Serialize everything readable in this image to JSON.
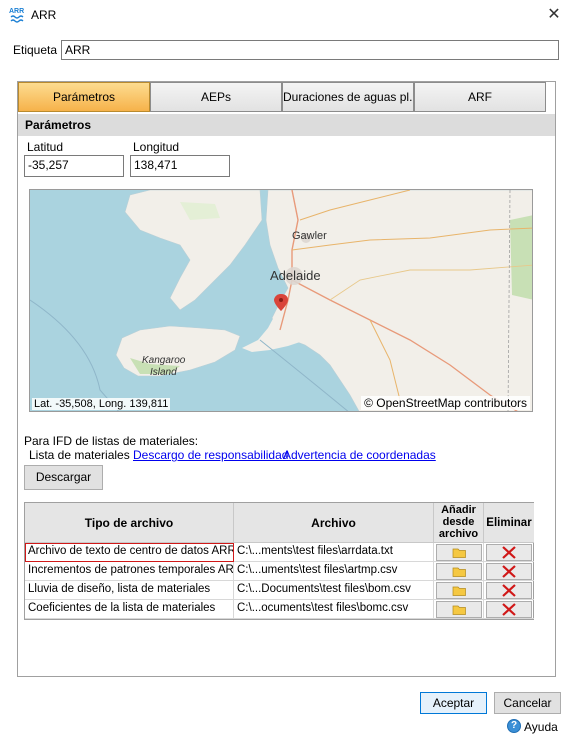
{
  "window": {
    "title": "ARR",
    "icon_text": "ARR"
  },
  "etiqueta": {
    "label": "Etiqueta",
    "value": "ARR"
  },
  "tabs": [
    {
      "label": "Parámetros",
      "active": true
    },
    {
      "label": "AEPs",
      "active": false
    },
    {
      "label": "Duraciones de aguas pl...",
      "active": false
    },
    {
      "label": "ARF",
      "active": false
    }
  ],
  "section": {
    "title": "Parámetros"
  },
  "latitud": {
    "label": "Latitud",
    "value": "-35,257"
  },
  "longitud": {
    "label": "Longitud",
    "value": "138,471"
  },
  "map": {
    "coords": "Lat. -35,508, Long. 139,811",
    "attribution": "© OpenStreetMap contributors",
    "places": {
      "gawler": "Gawler",
      "adelaide": "Adelaide",
      "kangaroo1": "Kangaroo",
      "kangaroo2": "Island"
    },
    "colors": {
      "sea": "#aad3df",
      "land": "#f2efe9",
      "park": "#c8e0b5",
      "marker": "#d9443a"
    }
  },
  "ifd": {
    "caption": "Para IFD de listas de materiales:",
    "lista_label": "Lista de materiales",
    "link_descargo": "Descargo de responsabilidad",
    "link_advertencia": "Advertencia de coordenadas",
    "download_button": "Descargar"
  },
  "table": {
    "headers": {
      "tipo": "Tipo de archivo",
      "archivo": "Archivo",
      "anadir1": "Añadir",
      "anadir2": "desde",
      "anadir3": "archivo",
      "eliminar": "Eliminar"
    },
    "rows": [
      {
        "tipo": "Archivo de texto de centro de datos ARR",
        "archivo": "C:\\...ments\\test files\\arrdata.txt"
      },
      {
        "tipo": "Incrementos de patrones temporales ARR",
        "archivo": "C:\\...uments\\test files\\artmp.csv"
      },
      {
        "tipo": "Lluvia de diseño, lista de materiales",
        "archivo": "C:\\...Documents\\test files\\bom.csv"
      },
      {
        "tipo": "Coeficientes de la lista de materiales",
        "archivo": "C:\\...ocuments\\test files\\bomc.csv"
      }
    ]
  },
  "footer": {
    "accept": "Aceptar",
    "cancel": "Cancelar",
    "help": "Ayuda"
  }
}
